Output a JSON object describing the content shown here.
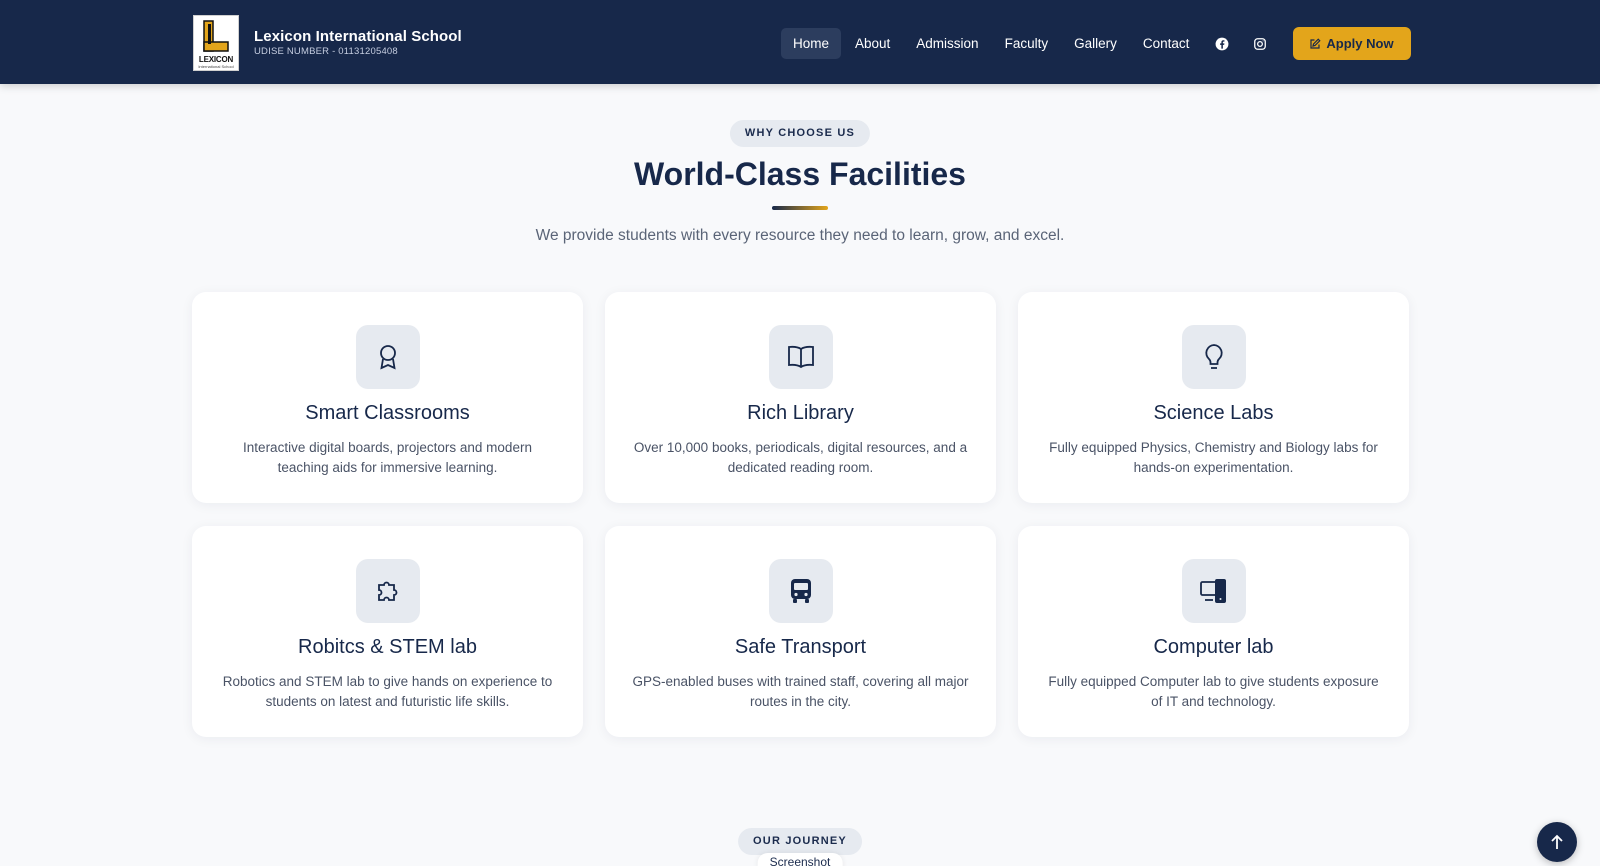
{
  "header": {
    "logo_text": "LEXICON",
    "logo_sub": "International School",
    "school_name": "Lexicon International School",
    "udise": "UDISE NUMBER - 01131205408",
    "nav": [
      "Home",
      "About",
      "Admission",
      "Faculty",
      "Gallery",
      "Contact"
    ],
    "active_nav": "Home",
    "social_icons": [
      "facebook-icon",
      "instagram-icon"
    ],
    "apply_label": "Apply Now",
    "colors": {
      "bar": "#17284a",
      "accent": "#e3a51b"
    }
  },
  "facilities": {
    "eyebrow": "WHY CHOOSE US",
    "title": "World-Class Facilities",
    "subtitle": "We provide students with every resource they need to learn, grow, and excel.",
    "cards": [
      {
        "icon": "award-icon",
        "title": "Smart Classrooms",
        "desc": "Interactive digital boards, projectors and modern teaching aids for immersive learning."
      },
      {
        "icon": "book-open-icon",
        "title": "Rich Library",
        "desc": "Over 10,000 books, periodicals, digital resources, and a dedicated reading room."
      },
      {
        "icon": "lightbulb-icon",
        "title": "Science Labs",
        "desc": "Fully equipped Physics, Chemistry and Biology labs for hands-on experimentation."
      },
      {
        "icon": "puzzle-icon",
        "title": "Robitcs & STEM lab",
        "desc": "Robotics and STEM lab to give hands on experience to students on latest and futuristic life skills."
      },
      {
        "icon": "bus-icon",
        "title": "Safe Transport",
        "desc": "GPS-enabled buses with trained staff, covering all major routes in the city."
      },
      {
        "icon": "devices-icon",
        "title": "Computer lab",
        "desc": "Fully equipped Computer lab to give students exposure of IT and technology."
      }
    ]
  },
  "journey": {
    "eyebrow": "OUR JOURNEY",
    "peek_label": "Screenshot"
  },
  "scroll_top_icon": "arrow-up-icon"
}
